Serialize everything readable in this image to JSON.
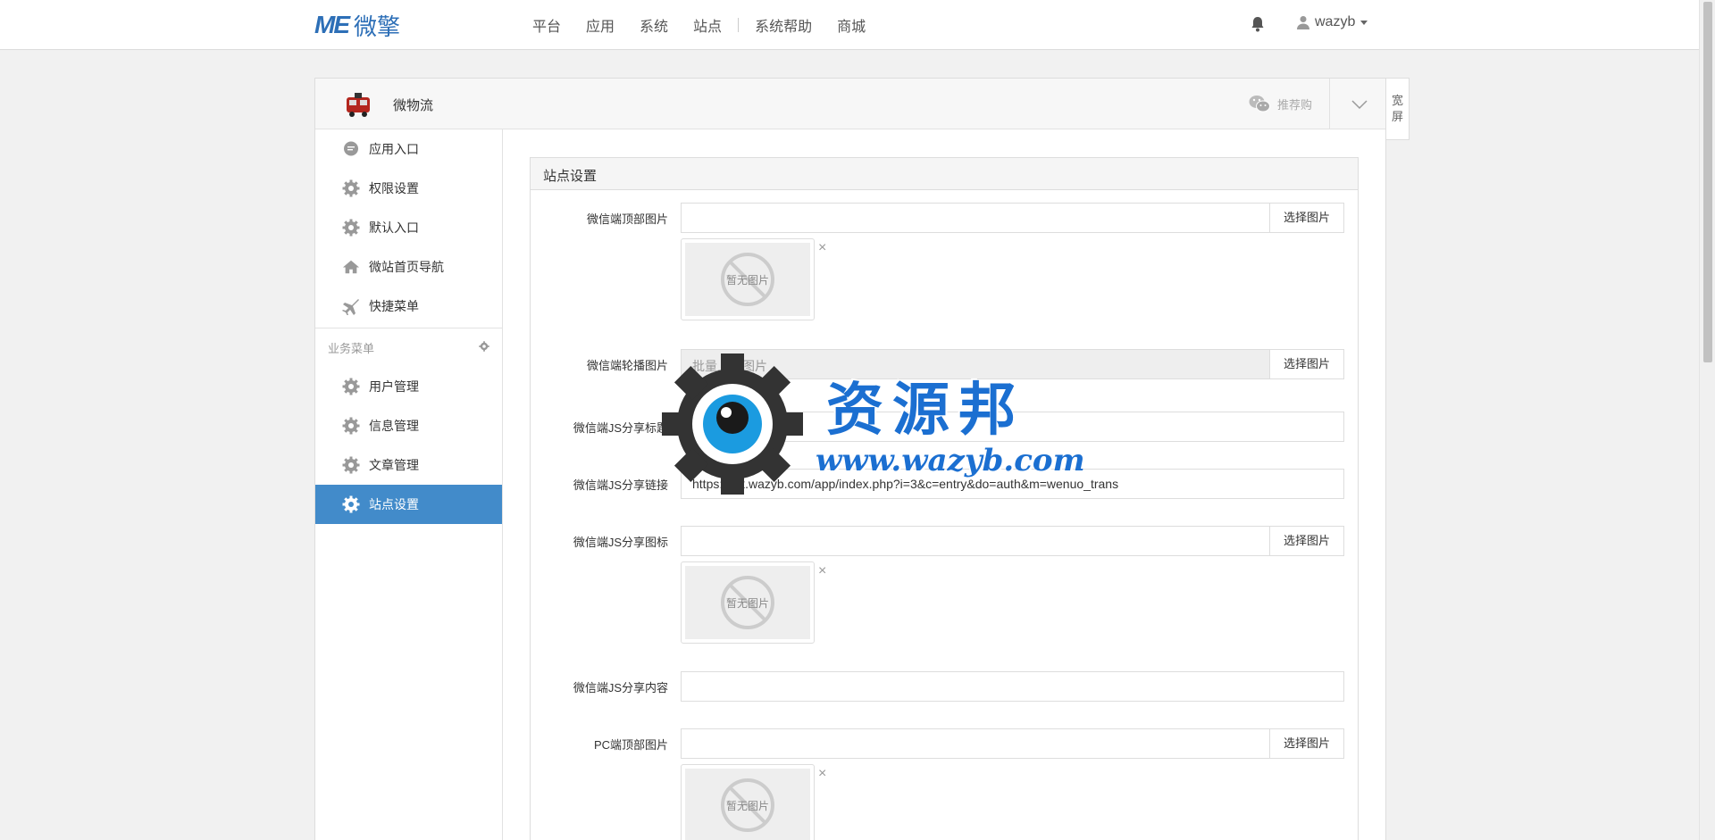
{
  "topnav": {
    "logo_mark": "ME",
    "logo_text": "微擎",
    "items": [
      "平台",
      "应用",
      "系统",
      "站点",
      "系统帮助",
      "商城"
    ],
    "username": "wazyb"
  },
  "app": {
    "name": "微物流",
    "wechat_label": "推荐购",
    "wide_label_1": "宽",
    "wide_label_2": "屏"
  },
  "sidebar": {
    "items": [
      {
        "label": "应用入口",
        "icon": "chat-bubble-icon"
      },
      {
        "label": "权限设置",
        "icon": "gear-icon"
      },
      {
        "label": "默认入口",
        "icon": "gear-icon"
      },
      {
        "label": "微站首页导航",
        "icon": "home-icon"
      },
      {
        "label": "快捷菜单",
        "icon": "plane-icon"
      }
    ],
    "group_label": "业务菜单",
    "group_items": [
      {
        "label": "用户管理",
        "icon": "gear-icon"
      },
      {
        "label": "信息管理",
        "icon": "gear-icon"
      },
      {
        "label": "文章管理",
        "icon": "gear-icon"
      },
      {
        "label": "站点设置",
        "icon": "gear-icon",
        "active": true
      }
    ]
  },
  "panel": {
    "title": "站点设置",
    "fields": [
      {
        "label": "微信端顶部图片",
        "value": "",
        "button": "选择图片"
      },
      {
        "label": "微信端轮播图片",
        "placeholder": "批量上传图片",
        "button": "选择图片"
      },
      {
        "label": "微信端JS分享标题",
        "value": ""
      },
      {
        "label": "微信端JS分享链接",
        "value": "https://wx.wazyb.com/app/index.php?i=3&c=entry&do=auth&m=wenuo_trans"
      },
      {
        "label": "微信端JS分享图标",
        "value": "",
        "button": "选择图片"
      },
      {
        "label": "微信端JS分享内容",
        "value": ""
      },
      {
        "label": "PC端顶部图片",
        "value": "",
        "button": "选择图片"
      }
    ],
    "no_image_text": "暂无图片",
    "close_glyph": "×"
  },
  "watermark": {
    "title": "资源邦",
    "url": "www.wazyb.com"
  },
  "colors": {
    "accent": "#428bca",
    "logo": "#2d6fb7",
    "watermark": "#1b6fd1"
  }
}
